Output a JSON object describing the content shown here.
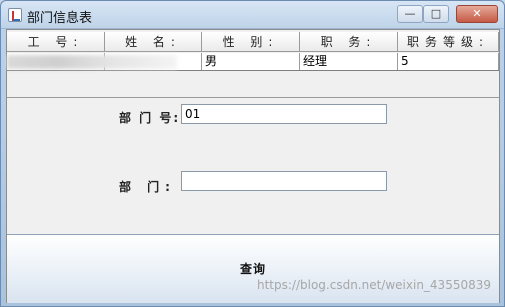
{
  "window": {
    "title": "部门信息表",
    "minimize": "—",
    "maximize": "□",
    "close": "✕"
  },
  "table": {
    "headers": [
      "工 号:",
      "姓 名:",
      "性 别:",
      "职 务:",
      "职务等级:"
    ],
    "row": [
      "",
      "",
      "男",
      "经理",
      "5"
    ]
  },
  "form": {
    "dept_no_label": "部 门 号:",
    "dept_no_value": "01",
    "dept_label": "部  门:",
    "dept_value": ""
  },
  "query_button": "查询",
  "watermark": "https://blog.csdn.net/weixin_43550839",
  "colors": {
    "title_bar": "#c7dbee",
    "close_button": "#c55a45",
    "panel": "#f0f0f0"
  }
}
